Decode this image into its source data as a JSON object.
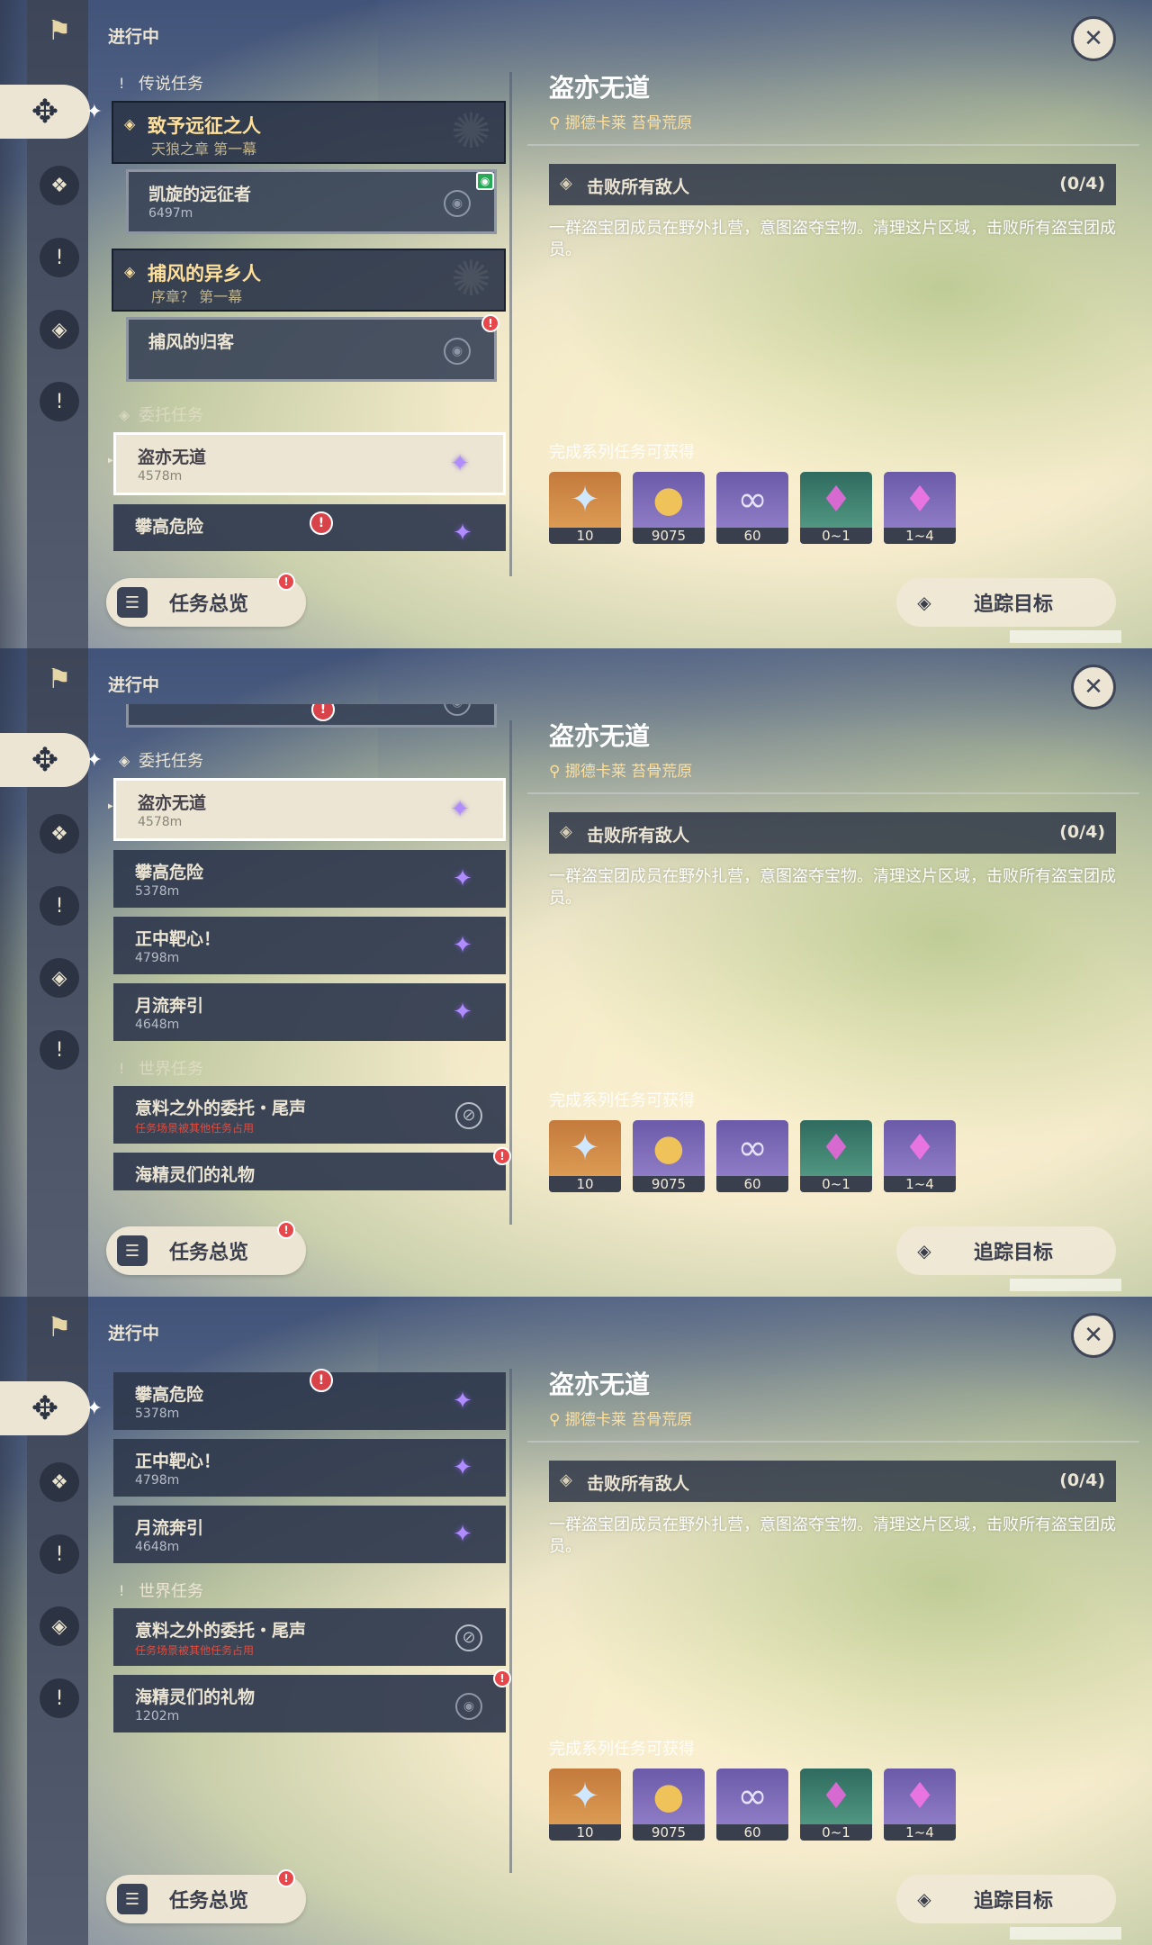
{
  "header": {
    "status_title": "进行中"
  },
  "sections": {
    "legend": "传说任务",
    "commission": "委托任务",
    "world": "世界任务"
  },
  "quests": {
    "legend1": {
      "title": "致予远征之人",
      "sub": "天狼之章 第一幕"
    },
    "legend1_child": {
      "title": "凯旋的远征者",
      "distance": "6497m"
    },
    "legend2": {
      "title": "捕风的异乡人",
      "sub": "序章？ 第一幕"
    },
    "legend2_child": {
      "title": "捕风的归客"
    },
    "c1": {
      "title": "盗亦无道",
      "distance": "4578m"
    },
    "c2": {
      "title": "攀高危险",
      "distance": "5378m"
    },
    "c3": {
      "title": "正中靶心！",
      "distance": "4798m"
    },
    "c4": {
      "title": "月流奔引",
      "distance": "4648m"
    },
    "w1": {
      "title": "意料之外的委托・尾声",
      "note": "任务场景被其他任务占用"
    },
    "w2": {
      "title": "海精灵们的礼物",
      "distance": "1202m"
    }
  },
  "detail": {
    "title": "盗亦无道",
    "location": "挪德卡莱 苔骨荒原",
    "objective": "击败所有敌人",
    "progress": "(0/4)",
    "description": "一群盗宝团成员在野外扎营，意图盗夺宝物。清理这片区域，击败所有盗宝团成员。",
    "rewards_header": "完成系列任务可获得",
    "rewards": [
      {
        "icon": "primogem-icon",
        "count": "10"
      },
      {
        "icon": "mora-icon",
        "count": "9075"
      },
      {
        "icon": "exp-icon",
        "count": "60"
      },
      {
        "icon": "crystal-chunk-icon",
        "count": "0~1"
      },
      {
        "icon": "crystal-cluster-icon",
        "count": "1~4"
      }
    ]
  },
  "buttons": {
    "overview": "任务总览",
    "track": "追踪目标"
  },
  "icons": {
    "rail": [
      "quest-book-icon",
      "commission-icon",
      "legend-icon",
      "world-icon",
      "event-icon",
      "misc-icon"
    ]
  }
}
